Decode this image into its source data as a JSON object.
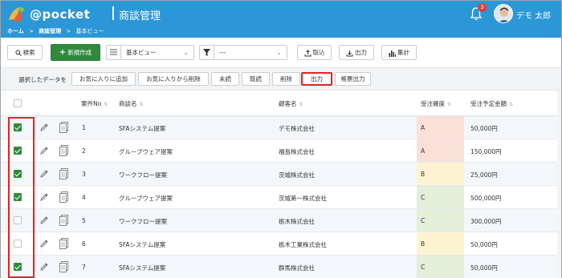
{
  "header": {
    "brand": "@pocket",
    "page_title": "商談管理",
    "notification_count": "3",
    "user_name": "デモ 太郎"
  },
  "breadcrumb": [
    "ホーム",
    ">",
    "商談管理",
    ">",
    "基本ビュー"
  ],
  "toolbar": {
    "search_label": "検索",
    "new_label": "新規作成",
    "view_value": "基本ビュー",
    "filter_value": "---",
    "import_label": "取込",
    "export_label": "出力",
    "aggregate_label": "集計"
  },
  "action_bar": {
    "label": "選択したデータを",
    "buttons": [
      "お気に入りに追加",
      "お気に入りから削除",
      "未読",
      "既読",
      "削除",
      "出力",
      "帳票出力"
    ]
  },
  "table": {
    "columns": [
      "案件No",
      "商談名",
      "顧客名",
      "受注確度",
      "受注予定金額"
    ],
    "rows": [
      {
        "checked": true,
        "no": "1",
        "name": "SFAシステム提案",
        "customer": "デモ株式会社",
        "rank": "A",
        "amount": "50,000円"
      },
      {
        "checked": true,
        "no": "2",
        "name": "グループウェア提案",
        "customer": "福島株式会社",
        "rank": "A",
        "amount": "150,000円"
      },
      {
        "checked": true,
        "no": "3",
        "name": "ワークフロー提案",
        "customer": "茨城株式会社",
        "rank": "B",
        "amount": "25,000円"
      },
      {
        "checked": true,
        "no": "4",
        "name": "グループウェア提案",
        "customer": "茨城第一株式会社",
        "rank": "C",
        "amount": "500,000円"
      },
      {
        "checked": false,
        "no": "5",
        "name": "ワークフロー提案",
        "customer": "栃木株式会社",
        "rank": "C",
        "amount": "300,000円"
      },
      {
        "checked": false,
        "no": "6",
        "name": "SFAシステム提案",
        "customer": "栃木工業株式会社",
        "rank": "B",
        "amount": "50,000円"
      },
      {
        "checked": true,
        "no": "7",
        "name": "SFAシステム提案",
        "customer": "群馬株式会社",
        "rank": "C",
        "amount": "50,000円"
      }
    ]
  },
  "colors": {
    "header_bg": "#2b97d6",
    "primary_green": "#2f8a3e",
    "rank_A": "#fbe0d8",
    "rank_B": "#fdf3d0",
    "rank_C": "#e3efd9",
    "highlight_red": "#e02424"
  }
}
